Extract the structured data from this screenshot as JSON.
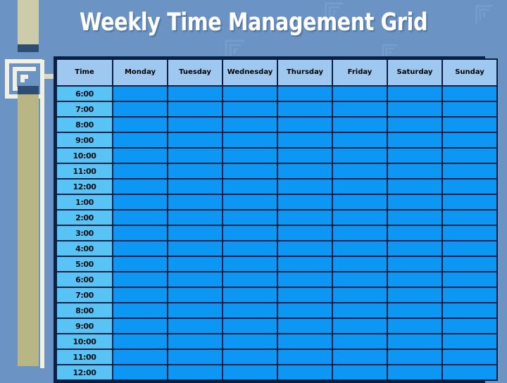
{
  "page": {
    "title": "Weekly Time Management Grid",
    "background_color": "#6b94c4"
  },
  "decor": {
    "khaki_color": "#ccccaa",
    "khaki_alt_color": "#b8b684",
    "navy_color": "#2e4d70",
    "cream_color": "#f2f0e2",
    "spiral_icon": "greek-key-spiral-icon"
  },
  "colors": {
    "header_cell": "#9ec8ef",
    "time_cell": "#57c4f5",
    "slot_cell": "#0d97f5",
    "border": "#0a1f44",
    "title_text": "#ffffff"
  },
  "table": {
    "headers": [
      "Time",
      "Monday",
      "Tuesday",
      "Wednesday",
      "Thursday",
      "Friday",
      "Saturday",
      "Sunday"
    ],
    "times": [
      "6:00",
      "7:00",
      "8:00",
      "9:00",
      "10:00",
      "11:00",
      "12:00",
      "1:00",
      "2:00",
      "3:00",
      "4:00",
      "5:00",
      "6:00",
      "7:00",
      "8:00",
      "9:00",
      "10:00",
      "11:00",
      "12:00"
    ],
    "slot_values": [
      [
        "",
        "",
        "",
        "",
        "",
        "",
        ""
      ],
      [
        "",
        "",
        "",
        "",
        "",
        "",
        ""
      ],
      [
        "",
        "",
        "",
        "",
        "",
        "",
        ""
      ],
      [
        "",
        "",
        "",
        "",
        "",
        "",
        ""
      ],
      [
        "",
        "",
        "",
        "",
        "",
        "",
        ""
      ],
      [
        "",
        "",
        "",
        "",
        "",
        "",
        ""
      ],
      [
        "",
        "",
        "",
        "",
        "",
        "",
        ""
      ],
      [
        "",
        "",
        "",
        "",
        "",
        "",
        ""
      ],
      [
        "",
        "",
        "",
        "",
        "",
        "",
        ""
      ],
      [
        "",
        "",
        "",
        "",
        "",
        "",
        ""
      ],
      [
        "",
        "",
        "",
        "",
        "",
        "",
        ""
      ],
      [
        "",
        "",
        "",
        "",
        "",
        "",
        ""
      ],
      [
        "",
        "",
        "",
        "",
        "",
        "",
        ""
      ],
      [
        "",
        "",
        "",
        "",
        "",
        "",
        ""
      ],
      [
        "",
        "",
        "",
        "",
        "",
        "",
        ""
      ],
      [
        "",
        "",
        "",
        "",
        "",
        "",
        ""
      ],
      [
        "",
        "",
        "",
        "",
        "",
        "",
        ""
      ],
      [
        "",
        "",
        "",
        "",
        "",
        "",
        ""
      ],
      [
        "",
        "",
        "",
        "",
        "",
        "",
        ""
      ]
    ]
  }
}
